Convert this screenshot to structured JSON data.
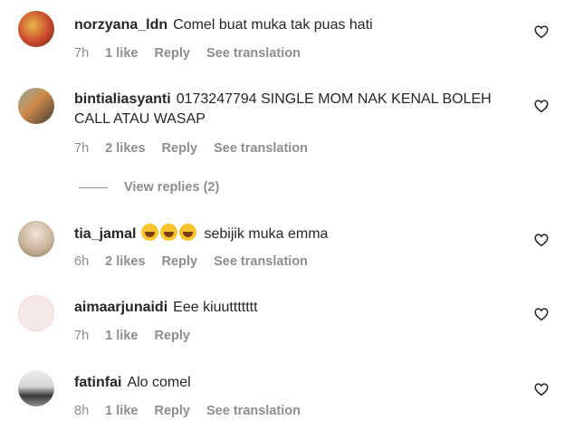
{
  "comments": [
    {
      "username": "norzyana_ldn",
      "text": "Comel buat muka tak puas hati",
      "time": "7h",
      "likes": "1 like",
      "reply": "Reply",
      "translate": "See translation"
    },
    {
      "username": "bintialiasyanti",
      "text": "0173247794 SINGLE MOM NAK KENAL BOLEH CALL ATAU WASAP",
      "time": "7h",
      "likes": "2 likes",
      "reply": "Reply",
      "translate": "See translation",
      "view_replies": "View replies (2)"
    },
    {
      "username": "tia_jamal",
      "text": "sebijik muka emma",
      "time": "6h",
      "likes": "2 likes",
      "reply": "Reply",
      "translate": "See translation"
    },
    {
      "username": "aimaarjunaidi",
      "text": "Eee kiuuttttttt",
      "time": "7h",
      "likes": "1 like",
      "reply": "Reply"
    },
    {
      "username": "fatinfai",
      "text": "Alo comel",
      "time": "8h",
      "likes": "1 like",
      "reply": "Reply",
      "translate": "See translation"
    }
  ],
  "emoji_count": 3,
  "colors": {
    "text": "#262626",
    "muted": "#8e8e8e",
    "background": "#ffffff"
  },
  "icons": {
    "like": "heart-outline-icon"
  }
}
